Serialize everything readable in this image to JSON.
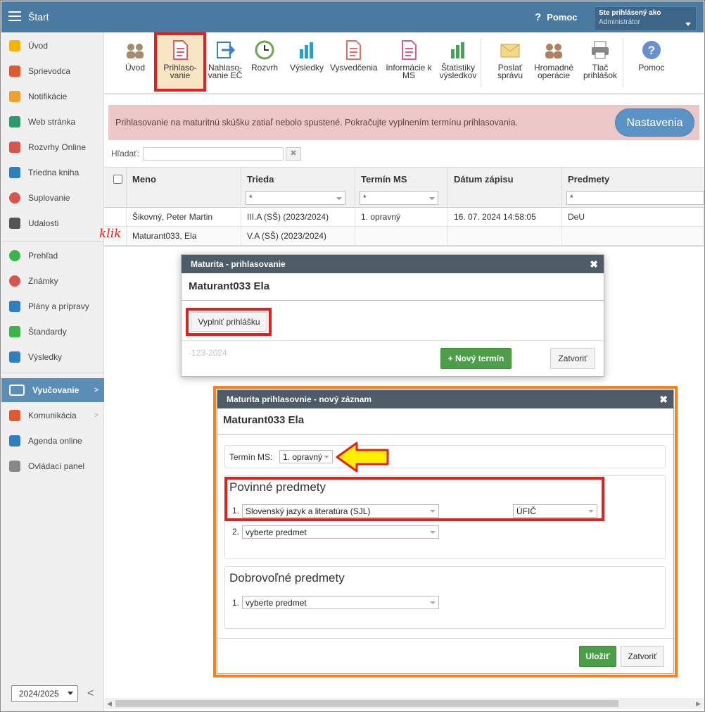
{
  "app": {
    "title": "Štart",
    "help_label": "Pomoc",
    "user_line1": "Ste prihlásený ako",
    "user_line2": "Administrátor"
  },
  "sidebar": {
    "items": [
      {
        "label": "Úvod",
        "icon": "star-icon",
        "color": "#f5b400"
      },
      {
        "label": "Sprievodca",
        "icon": "wand-icon",
        "color": "#e05a30"
      },
      {
        "label": "Notifikácie",
        "icon": "envelope-icon",
        "color": "#f0a030"
      },
      {
        "label": "Web stránka",
        "icon": "home-icon",
        "color": "#2b9a6a"
      },
      {
        "label": "Rozvrhy Online",
        "icon": "calendar-grid-icon",
        "color": "#d9534f"
      },
      {
        "label": "Triedna kniha",
        "icon": "book-icon",
        "color": "#2e7fc0"
      },
      {
        "label": "Suplovanie",
        "icon": "person-icon",
        "color": "#d9534f"
      },
      {
        "label": "Udalosti",
        "icon": "calendar-icon",
        "color": "#555555"
      },
      {
        "label": "Prehľad",
        "icon": "check-circle-icon",
        "color": "#3ab54a"
      },
      {
        "label": "Známky",
        "icon": "grade-icon",
        "color": "#d9534f"
      },
      {
        "label": "Plány a prípravy",
        "icon": "briefcase-icon",
        "color": "#2e7fc0"
      },
      {
        "label": "Štandardy",
        "icon": "shield-icon",
        "color": "#3ab54a"
      },
      {
        "label": "Výsledky",
        "icon": "bar-chart-icon",
        "color": "#2e7fc0"
      },
      {
        "label": "Vyučovanie",
        "icon": "open-book-icon",
        "color": "#ffffff"
      },
      {
        "label": "Komunikácia",
        "icon": "chat-icon",
        "color": "#e05a30"
      },
      {
        "label": "Agenda online",
        "icon": "pen-icon",
        "color": "#2e7fc0"
      },
      {
        "label": "Ovládací panel",
        "icon": "gear-icon",
        "color": "#888888"
      }
    ],
    "year": "2024/2025"
  },
  "toolbar": {
    "items": [
      {
        "label": "Úvod",
        "icon": "graduates-icon"
      },
      {
        "label": "Prihlaso- vanie",
        "icon": "form-icon"
      },
      {
        "label": "Nahlaso- vanie EČ",
        "icon": "export-icon"
      },
      {
        "label": "Rozvrh",
        "icon": "clock-icon"
      },
      {
        "label": "Výsledky",
        "icon": "bar-chart-icon"
      },
      {
        "label": "Vysvedčenia",
        "icon": "certificate-icon"
      },
      {
        "label": "Informácie k MS",
        "icon": "document-icon"
      },
      {
        "label": "Štatistiky výsledkov",
        "icon": "stats-icon"
      },
      {
        "label": "Poslať správu",
        "icon": "envelope-icon"
      },
      {
        "label": "Hromadné operácie",
        "icon": "group-icon"
      },
      {
        "label": "Tlač prihlášok",
        "icon": "printer-icon"
      },
      {
        "label": "Pomoc",
        "icon": "help-icon"
      }
    ]
  },
  "banner": {
    "text": "Prihlasovanie na maturitnú skúšku zatiaľ nebolo spustené. Pokračujte vyplnením termínu prihlasovania.",
    "button": "Nastavenia"
  },
  "search": {
    "label": "Hľadať:",
    "clear": "✖"
  },
  "grid": {
    "columns": [
      "Meno",
      "Trieda",
      "Termín MS",
      "Dátum zápisu",
      "Predmety"
    ],
    "filter_value": "*",
    "rows": [
      [
        "Šikovný, Peter Martin",
        "III.A (SŠ) (2023/2024)",
        "1. opravný",
        "16. 07. 2024 14:58:05",
        "DeU"
      ],
      [
        "Maturant033, Ela",
        "V.A (SŠ) (2023/2024)",
        "",
        "",
        ""
      ]
    ],
    "annotation": "klik"
  },
  "dialog1": {
    "title": "Maturita - prihlasovanie",
    "name": "Maturant033 Ela",
    "fill_button": "Vyplniť prihlášku",
    "faded_text": "-123-2024",
    "new_term_button": "+ Nový termín",
    "close_button": "Zatvoriť"
  },
  "dialog2": {
    "title": "Maturita prihlasovnie - nový záznam",
    "name": "Maturant033 Ela",
    "term_label": "Termín MS:",
    "term_value": "1. opravný",
    "mandatory_title": "Povinné predmety",
    "mandatory": [
      {
        "num": "1.",
        "subject": "Slovenský jazyk a literatúra (SJL)",
        "level": "ÚFIČ"
      },
      {
        "num": "2.",
        "subject": "vyberte predmet"
      }
    ],
    "optional_title": "Dobrovoľné predmety",
    "optional": [
      {
        "num": "1.",
        "subject": "vyberte predmet"
      }
    ],
    "save_button": "Uložiť",
    "close_button": "Zatvoriť"
  },
  "colors": {
    "topbar": "#4a7aa2",
    "highlight_red": "#e12020",
    "highlight_orange": "#f58220",
    "arrow_yellow": "#ffee00",
    "green": "#4c9e49"
  }
}
